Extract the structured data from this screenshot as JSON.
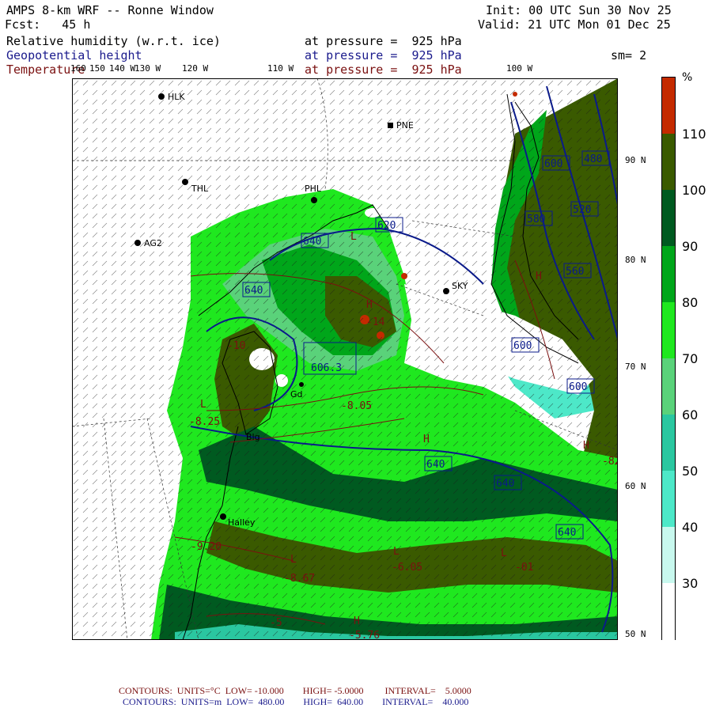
{
  "header": {
    "title": "AMPS 8-km WRF -- Ronne Window",
    "fcst": "Fcst:   45 h",
    "init": "Init: 00 UTC Sun 30 Nov 25",
    "valid": "Valid: 21 UTC Mon 01 Dec 25",
    "fields": [
      {
        "name": "Relative humidity (w.r.t. ice)",
        "level": "at pressure =  925 hPa"
      },
      {
        "name": "Geopotential height",
        "level": "at pressure =  925 hPa"
      },
      {
        "name": "Temperature",
        "level": "at pressure =  925 hPa"
      }
    ],
    "smoothing": "sm= 2"
  },
  "axes": {
    "lon_labels": [
      "160",
      "150",
      "140 W",
      "130 W",
      "120 W",
      "110 W",
      "100 W"
    ],
    "lat_labels": [
      "90 N",
      "80 N",
      "70 N",
      "60 N",
      "50 N"
    ]
  },
  "stations": [
    {
      "id": "HLK"
    },
    {
      "id": "PNE"
    },
    {
      "id": "THL"
    },
    {
      "id": "PHL"
    },
    {
      "id": "AG2"
    },
    {
      "id": "SKY"
    },
    {
      "id": "Halley"
    },
    {
      "id": "Gd"
    },
    {
      "id": "Blg"
    }
  ],
  "contour_labels": {
    "height": [
      "640",
      "640",
      "640",
      "620",
      "600",
      "580",
      "560",
      "520",
      "480",
      "600",
      "600",
      "640",
      "640",
      "640",
      "606.3"
    ],
    "temperature": [
      "-10",
      "-8.05",
      "-8.25",
      "-9.20",
      "-8.67",
      "-6.05",
      "-5.76",
      "-5",
      "-82",
      "-01",
      "-14"
    ],
    "extrema": [
      "H",
      "H",
      "H",
      "L",
      "L",
      "L",
      "H",
      "H",
      "L",
      "L"
    ]
  },
  "colorbar": {
    "unit": "%",
    "ticks": [
      "110",
      "100",
      "90",
      "80",
      "70",
      "60",
      "50",
      "40",
      "30"
    ],
    "colors": [
      "#c42a00",
      "#3a5a00",
      "#005a20",
      "#00a61a",
      "#1fe81f",
      "#5ad27a",
      "#2ac7a0",
      "#4de8c8",
      "#c8f8ee",
      "#ffffff"
    ]
  },
  "footer": {
    "line1": "CONTOURS:  UNITS=°C  LOW= -10.000        HIGH= -5.0000         INTERVAL=    5.0000",
    "line2": "CONTOURS:  UNITS=m  LOW=  480.00        HIGH=  640.00        INTERVAL=    40.000"
  }
}
